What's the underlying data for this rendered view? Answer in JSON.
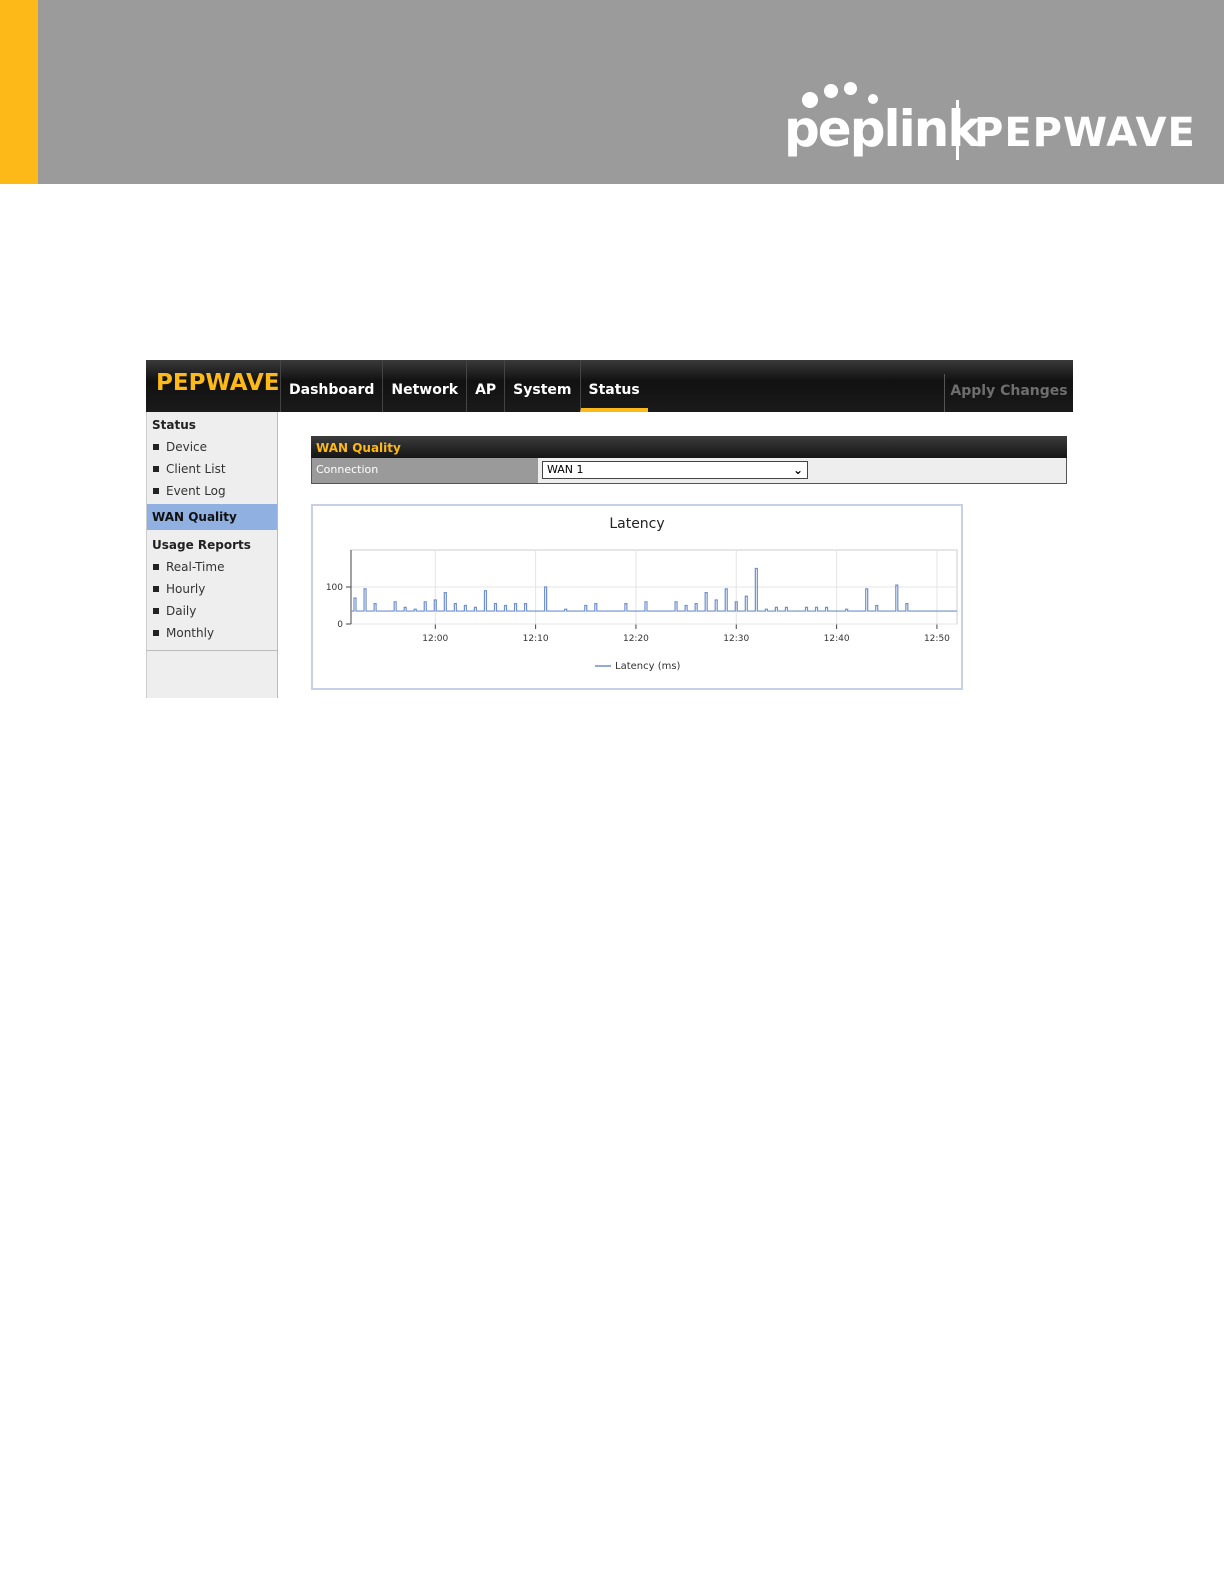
{
  "banner": {
    "accent_color": "#fdb917",
    "background_color": "#9b9b9b",
    "brand_primary": "peplink",
    "brand_secondary": "PEPWAVE"
  },
  "ui": {
    "logo": "PEPWAVE",
    "nav": [
      {
        "label": "Dashboard",
        "active": false
      },
      {
        "label": "Network",
        "active": false
      },
      {
        "label": "AP",
        "active": false
      },
      {
        "label": "System",
        "active": false
      },
      {
        "label": "Status",
        "active": true
      }
    ],
    "apply_label": "Apply Changes",
    "sidebar": {
      "status_heading": "Status",
      "status_items": [
        "Device",
        "Client List",
        "Event Log"
      ],
      "active_item": "WAN Quality",
      "usage_heading": "Usage Reports",
      "usage_items": [
        "Real-Time",
        "Hourly",
        "Daily",
        "Monthly"
      ]
    },
    "panel": {
      "title": "WAN Quality",
      "connection_label": "Connection",
      "connection_value": "WAN 1"
    }
  },
  "chart_data": {
    "type": "line",
    "title": "Latency",
    "x_tick_labels": [
      "12:00",
      "12:10",
      "12:20",
      "12:30",
      "12:40",
      "12:50"
    ],
    "y_tick_labels": [
      "0",
      "100"
    ],
    "ylim": [
      0,
      200
    ],
    "series": [
      {
        "name": "Latency (ms)",
        "color": "#6f8fd0",
        "baseline": 35,
        "spikes": [
          {
            "t": "11:52",
            "v": 70
          },
          {
            "t": "11:53",
            "v": 95
          },
          {
            "t": "11:54",
            "v": 55
          },
          {
            "t": "11:56",
            "v": 60
          },
          {
            "t": "11:57",
            "v": 45
          },
          {
            "t": "11:58",
            "v": 40
          },
          {
            "t": "11:59",
            "v": 60
          },
          {
            "t": "12:00",
            "v": 65
          },
          {
            "t": "12:01",
            "v": 85
          },
          {
            "t": "12:02",
            "v": 55
          },
          {
            "t": "12:03",
            "v": 50
          },
          {
            "t": "12:04",
            "v": 45
          },
          {
            "t": "12:05",
            "v": 90
          },
          {
            "t": "12:06",
            "v": 55
          },
          {
            "t": "12:07",
            "v": 50
          },
          {
            "t": "12:08",
            "v": 55
          },
          {
            "t": "12:09",
            "v": 55
          },
          {
            "t": "12:11",
            "v": 100
          },
          {
            "t": "12:13",
            "v": 40
          },
          {
            "t": "12:15",
            "v": 50
          },
          {
            "t": "12:16",
            "v": 55
          },
          {
            "t": "12:19",
            "v": 55
          },
          {
            "t": "12:21",
            "v": 60
          },
          {
            "t": "12:24",
            "v": 60
          },
          {
            "t": "12:25",
            "v": 50
          },
          {
            "t": "12:26",
            "v": 55
          },
          {
            "t": "12:27",
            "v": 85
          },
          {
            "t": "12:28",
            "v": 65
          },
          {
            "t": "12:29",
            "v": 95
          },
          {
            "t": "12:30",
            "v": 60
          },
          {
            "t": "12:31",
            "v": 75
          },
          {
            "t": "12:32",
            "v": 150
          },
          {
            "t": "12:33",
            "v": 40
          },
          {
            "t": "12:34",
            "v": 45
          },
          {
            "t": "12:35",
            "v": 45
          },
          {
            "t": "12:37",
            "v": 45
          },
          {
            "t": "12:38",
            "v": 45
          },
          {
            "t": "12:39",
            "v": 45
          },
          {
            "t": "12:41",
            "v": 40
          },
          {
            "t": "12:43",
            "v": 95
          },
          {
            "t": "12:44",
            "v": 50
          },
          {
            "t": "12:46",
            "v": 105
          },
          {
            "t": "12:47",
            "v": 55
          }
        ]
      }
    ],
    "legend": "bottom-center",
    "grid": true
  }
}
